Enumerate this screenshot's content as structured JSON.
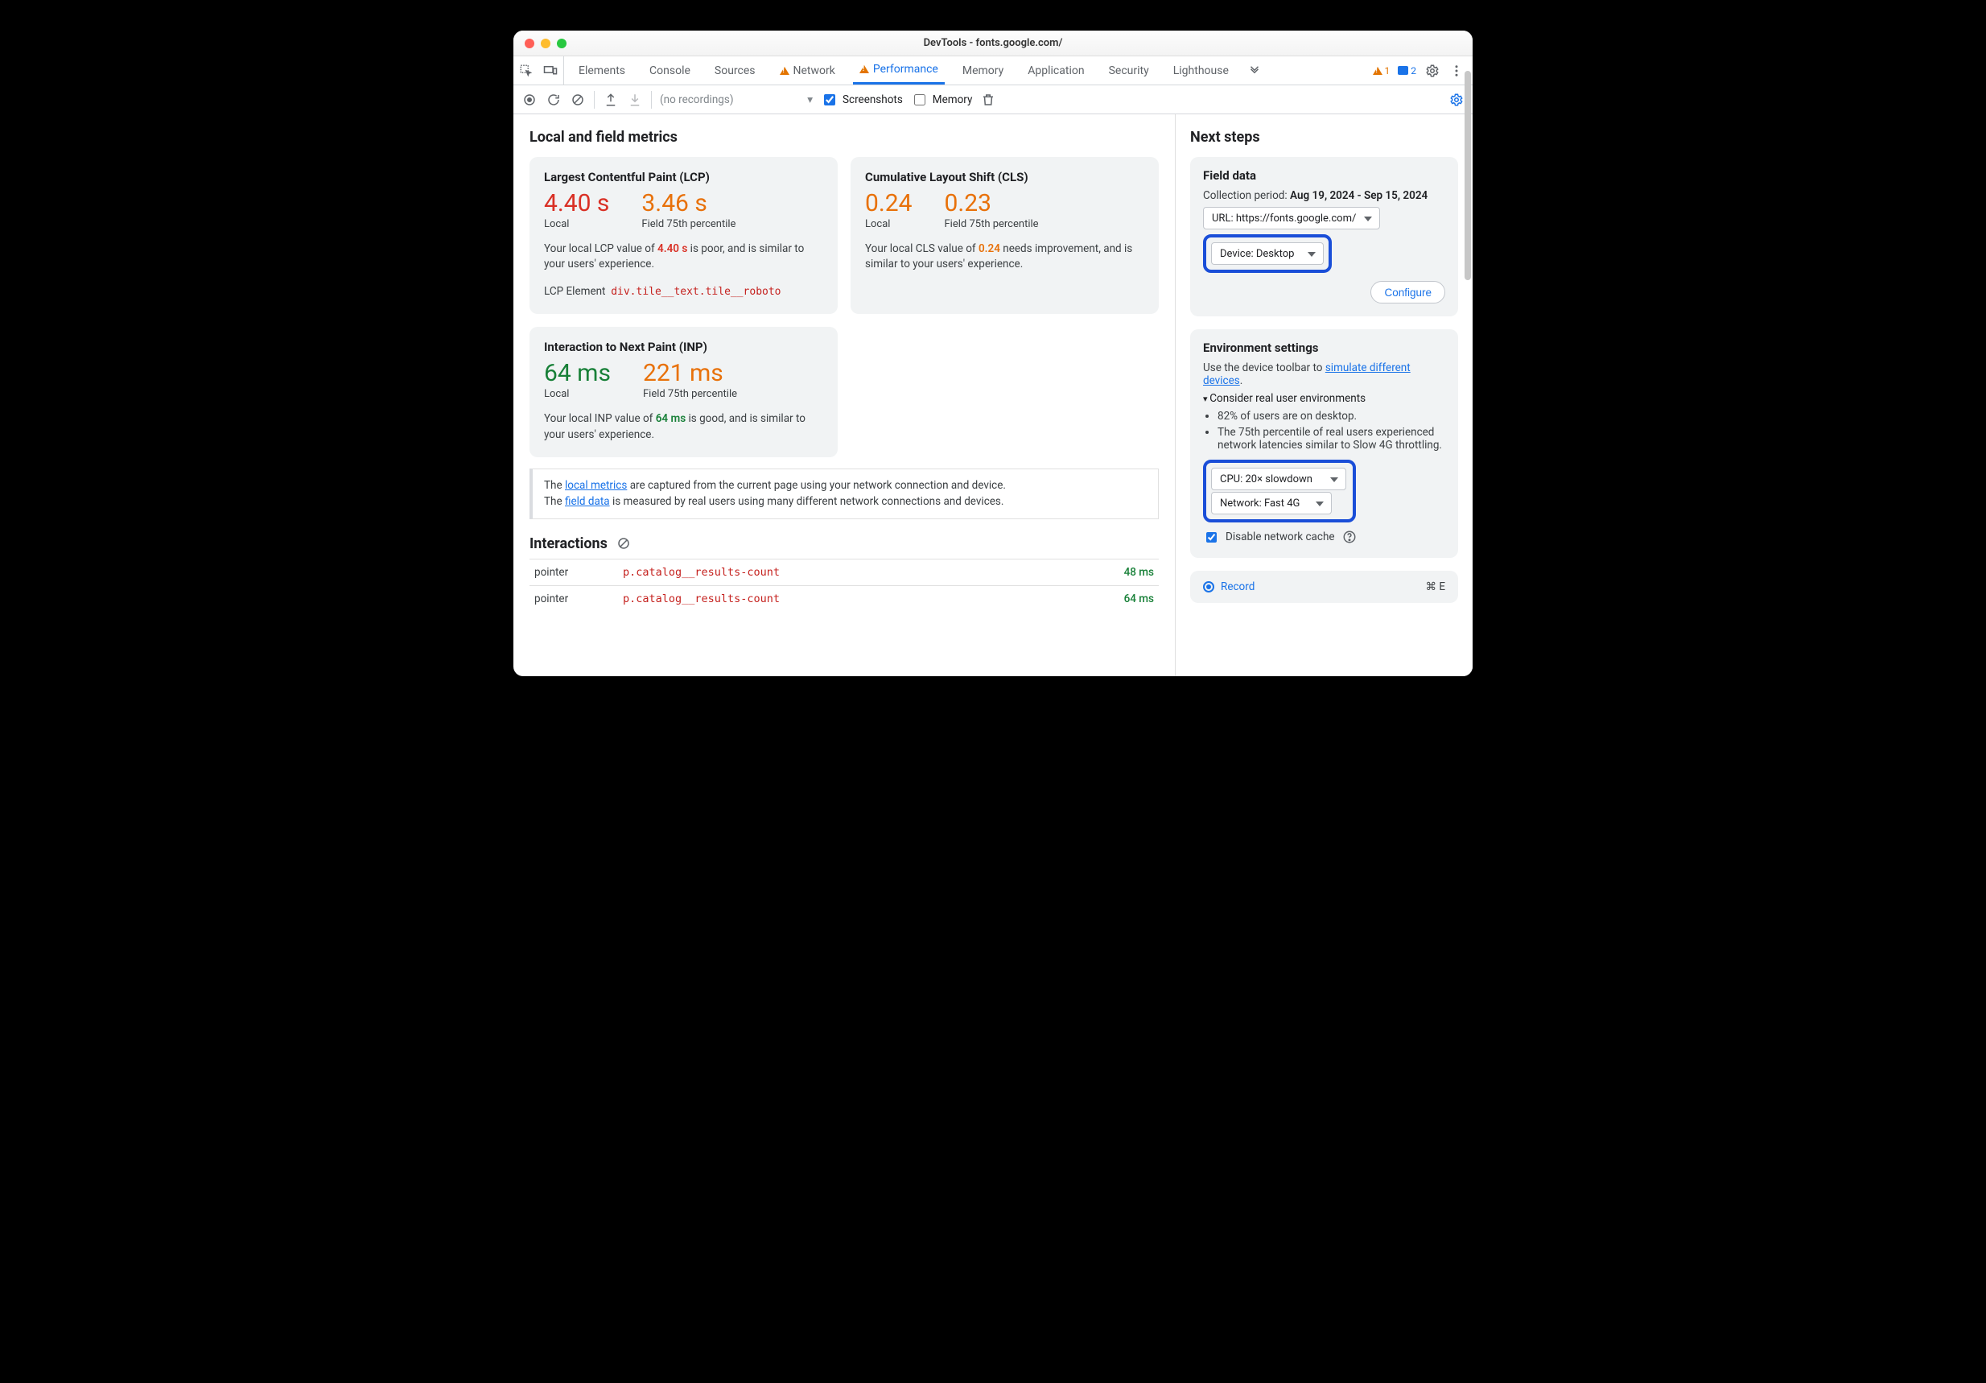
{
  "window": {
    "title": "DevTools - fonts.google.com/"
  },
  "tabs": {
    "items": [
      "Elements",
      "Console",
      "Sources",
      "Network",
      "Performance",
      "Memory",
      "Application",
      "Security",
      "Lighthouse"
    ],
    "network_warn": true,
    "performance_warn": true,
    "active": "Performance"
  },
  "topRight": {
    "warnings": "1",
    "issues": "2"
  },
  "toolbar": {
    "recordings_placeholder": "(no recordings)",
    "screenshots_label": "Screenshots",
    "memory_label": "Memory",
    "screenshots_checked": true,
    "memory_checked": false
  },
  "metrics": {
    "heading": "Local and field metrics",
    "lcp": {
      "title": "Largest Contentful Paint (LCP)",
      "local_value": "4.40 s",
      "local_label": "Local",
      "field_value": "3.46 s",
      "field_label": "Field 75th percentile",
      "text_pre": "Your local LCP value of ",
      "text_val": "4.40 s",
      "text_post": " is poor, and is similar to your users' experience.",
      "element_label": "LCP Element",
      "element_sel": "div.tile__text.tile__roboto"
    },
    "cls": {
      "title": "Cumulative Layout Shift (CLS)",
      "local_value": "0.24",
      "local_label": "Local",
      "field_value": "0.23",
      "field_label": "Field 75th percentile",
      "text_pre": "Your local CLS value of ",
      "text_val": "0.24",
      "text_post": " needs improvement, and is similar to your users' experience."
    },
    "inp": {
      "title": "Interaction to Next Paint (INP)",
      "local_value": "64 ms",
      "local_label": "Local",
      "field_value": "221 ms",
      "field_label": "Field 75th percentile",
      "text_pre": "Your local INP value of ",
      "text_val": "64 ms",
      "text_post": " is good, and is similar to your users' experience."
    }
  },
  "note": {
    "line1_pre": "The ",
    "line1_link": "local metrics",
    "line1_post": " are captured from the current page using your network connection and device.",
    "line2_pre": "The ",
    "line2_link": "field data",
    "line2_post": " is measured by real users using many different network connections and devices."
  },
  "interactions": {
    "heading": "Interactions",
    "rows": [
      {
        "kind": "pointer",
        "selector": "p.catalog__results-count",
        "time": "48 ms"
      },
      {
        "kind": "pointer",
        "selector": "p.catalog__results-count",
        "time": "64 ms"
      }
    ]
  },
  "nextsteps": {
    "heading": "Next steps",
    "field": {
      "title": "Field data",
      "period_label": "Collection period: ",
      "period_value": "Aug 19, 2024 - Sep 15, 2024",
      "url_select": "URL: https://fonts.google.com/",
      "device_select": "Device: Desktop",
      "configure": "Configure"
    },
    "env": {
      "title": "Environment settings",
      "desc_pre": "Use the device toolbar to ",
      "desc_link": "simulate different devices",
      "desc_post": ".",
      "summary": "Consider real user environments",
      "bullets": [
        "82% of users are on desktop.",
        "The 75th percentile of real users experienced network latencies similar to Slow 4G throttling."
      ],
      "cpu_select": "CPU: 20× slowdown",
      "net_select": "Network: Fast 4G",
      "cache_label": "Disable network cache",
      "cache_checked": true
    },
    "record": {
      "label": "Record",
      "shortcut": "⌘ E"
    }
  }
}
